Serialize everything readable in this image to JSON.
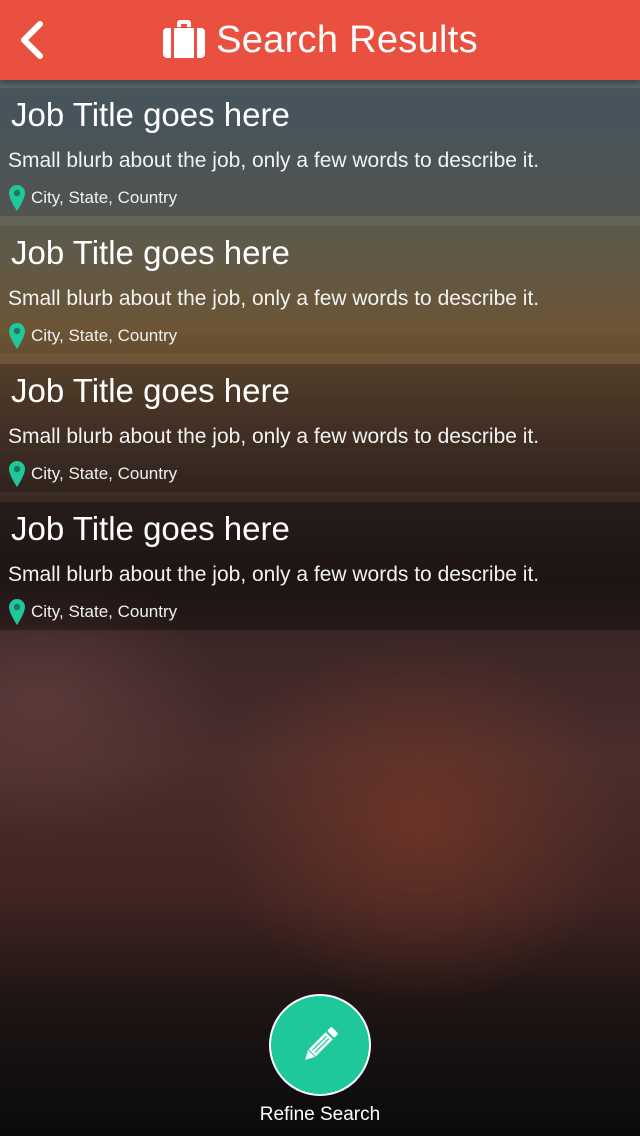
{
  "header": {
    "title": "Search Results",
    "back_icon": "chevron-left-icon",
    "title_icon": "briefcase-icon",
    "background": "#e9503f"
  },
  "jobs": [
    {
      "title": "Job Title goes here",
      "blurb": "Small blurb about the job, only a few words to describe it.",
      "location": "City, State, Country"
    },
    {
      "title": "Job Title goes here",
      "blurb": "Small blurb about the job, only a few words to describe it.",
      "location": "City, State, Country"
    },
    {
      "title": "Job Title goes here",
      "blurb": "Small blurb about the job, only a few words to describe it.",
      "location": "City, State, Country"
    },
    {
      "title": "Job Title goes here",
      "blurb": "Small blurb about the job, only a few words to describe it.",
      "location": "City, State, Country"
    }
  ],
  "location_icon": "map-pin-icon",
  "refine": {
    "label": "Refine Search",
    "icon": "pencil-icon",
    "color": "#1ec89a"
  },
  "colors": {
    "accent": "#1ec89a",
    "header": "#e9503f"
  }
}
